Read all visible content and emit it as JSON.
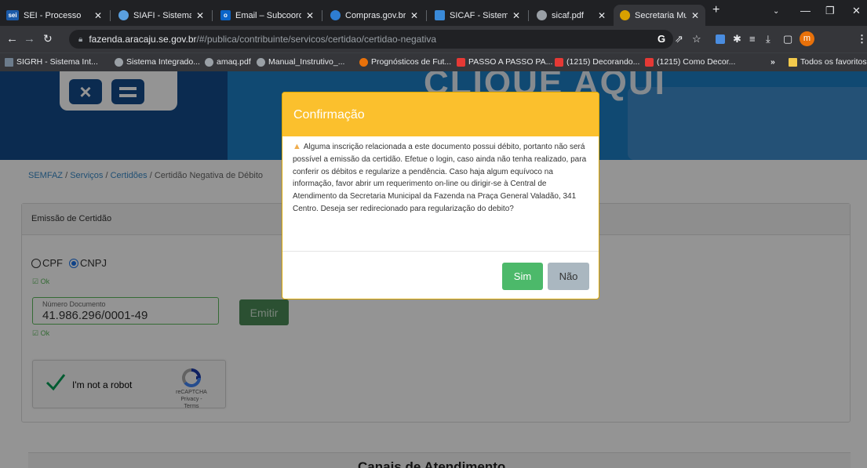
{
  "browser": {
    "tabs": [
      {
        "label": "SEI - Processo",
        "icon": "sei-icon",
        "icon_text": "sei",
        "icon_color": "#1a5aa8"
      },
      {
        "label": "SIAFI - Sistema In",
        "icon": "globe-icon",
        "icon_text": "",
        "icon_color": "#5aa0e0"
      },
      {
        "label": "Email – Subcoord",
        "icon": "outlook-icon",
        "icon_text": "o",
        "icon_color": "#0a64c8"
      },
      {
        "label": "Compras.gov.br -",
        "icon": "compras-icon",
        "icon_text": "",
        "icon_color": "#2e7dd2"
      },
      {
        "label": "SICAF - Sistema c",
        "icon": "sicaf-icon",
        "icon_text": "",
        "icon_color": "#3a8ad8"
      },
      {
        "label": "sicaf.pdf",
        "icon": "globe-icon",
        "icon_text": "",
        "icon_color": "#9aa0a6"
      },
      {
        "label": "Secretaria Munici",
        "icon": "crest-icon",
        "icon_text": "",
        "icon_color": "#d8a000"
      }
    ],
    "url_host": "fazenda.aracaju.se.gov.br",
    "url_path": "/#/publica/contribuinte/servicos/certidao/certidao-negativa",
    "avatar_letter": "m",
    "bookmarks": [
      {
        "label": "SIGRH - Sistema Int...",
        "color": "#6c7c8c"
      },
      {
        "label": "Sistema Integrado...",
        "color": "#9aa0a6"
      },
      {
        "label": "amaq.pdf",
        "color": "#9aa0a6"
      },
      {
        "label": "Manual_Instrutivo_...",
        "color": "#9aa0a6"
      },
      {
        "label": "Prognósticos de Fut...",
        "color": "#e8710a"
      },
      {
        "label": "PASSO A PASSO PA...",
        "color": "#e53935"
      },
      {
        "label": "(1215) Decorando...",
        "color": "#e53935"
      },
      {
        "label": "(1215) Como Decor...",
        "color": "#e53935"
      }
    ],
    "bookmarks_overflow": "»",
    "all_favorites": "Todos os favoritos"
  },
  "banner": {
    "cta": "CLIQUE AQUI"
  },
  "breadcrumb": {
    "items": [
      "SEMFAZ",
      "Serviços",
      "Certidões"
    ],
    "current": "Certidão Negativa de Débito",
    "separator": "/"
  },
  "form": {
    "card_title": "Emissão de Certidão",
    "radio_cpf": "CPF",
    "radio_cnpj": "CNPJ",
    "selected": "CNPJ",
    "ok_label": "Ok",
    "doc_label": "Número Documento",
    "doc_value": "41.986.296/0001-49",
    "emit_button": "Emitir"
  },
  "recaptcha": {
    "label": "I'm not a robot",
    "brand": "reCAPTCHA",
    "links": "Privacy - Terms"
  },
  "footer": {
    "title": "Canais de Atendimento"
  },
  "modal": {
    "title": "Confirmação",
    "message": "Alguma inscrição relacionada a este documento possui débito, portanto não será possível a emissão da certidão. Efetue o login, caso ainda não tenha realizado, para conferir os débitos e regularize a pendência. Caso haja algum equívoco na informação, favor abrir um requerimento on-line ou dirigir-se à Central de Atendimento da Secretaria Municipal da Fazenda na Praça General Valadão, 341 Centro. Deseja ser redirecionado para regularização do debito?",
    "yes": "Sim",
    "no": "Não",
    "header_color": "#fbc02d"
  }
}
